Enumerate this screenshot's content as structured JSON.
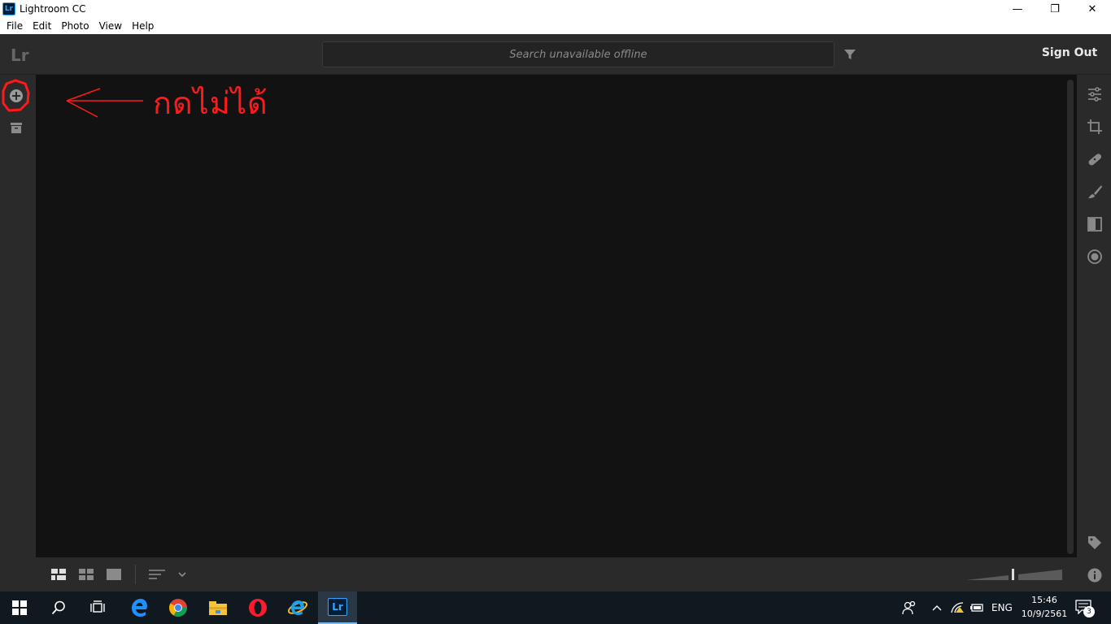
{
  "window": {
    "app_icon_label": "Lr",
    "title": "Lightroom CC",
    "minimize": "—",
    "maximize": "❐",
    "close": "✕"
  },
  "menu": [
    "File",
    "Edit",
    "Photo",
    "View",
    "Help"
  ],
  "header": {
    "logo": "Lr",
    "search_placeholder": "Search unavailable offline",
    "sign_out": "Sign Out"
  },
  "annotation": {
    "text": "กดไม่ได้",
    "color": "#ff1a1a"
  },
  "left_rail": [
    "add-photos-icon",
    "archive-icon"
  ],
  "right_rail": [
    "edit-sliders-icon",
    "crop-icon",
    "healing-icon",
    "brush-icon",
    "linear-gradient-icon",
    "radial-gradient-icon",
    "keyword-tag-icon",
    "info-icon"
  ],
  "bottom_bar": {
    "view_modes": [
      "square-grid-icon",
      "photo-grid-icon",
      "detail-view-icon"
    ],
    "sort_icon": "sort-lines-icon"
  },
  "taskbar": {
    "apps": [
      "start-icon",
      "search-icon",
      "task-view-icon",
      "edge-icon",
      "chrome-icon",
      "file-explorer-icon",
      "opera-icon",
      "internet-explorer-icon",
      "lightroom-icon"
    ],
    "lightroom_label": "Lr",
    "language": "ENG",
    "time": "15:46",
    "date": "10/9/2561",
    "notifications": "3"
  },
  "colors": {
    "panel": "#2a2a2a",
    "grid_bg": "#121212",
    "lr_blue": "#31a8ff"
  }
}
